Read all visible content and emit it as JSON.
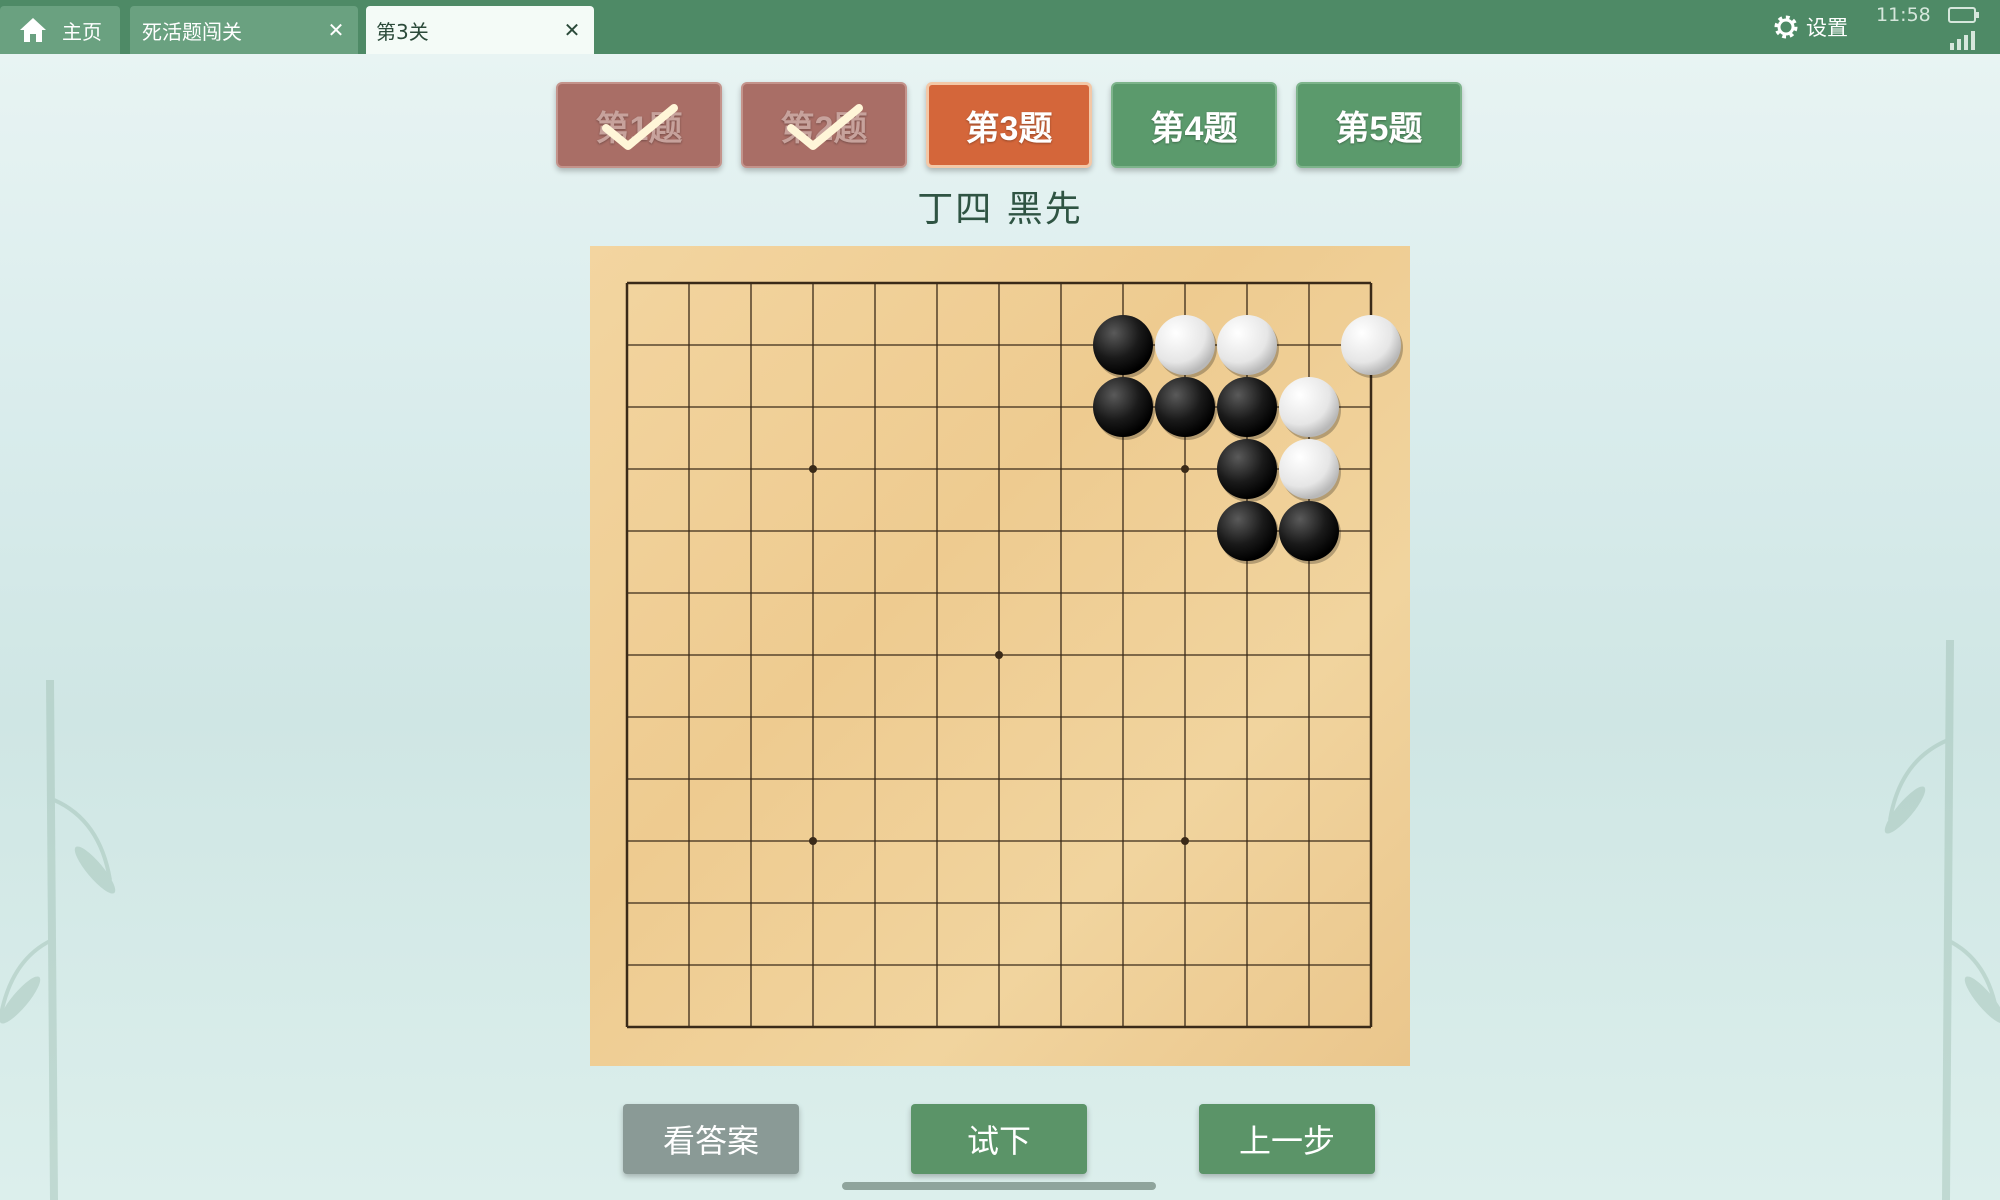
{
  "topbar": {
    "tabs": [
      {
        "label": "主页",
        "icon": "home-icon"
      },
      {
        "label": "死活题闯关",
        "close": "✕"
      },
      {
        "label": "第3关",
        "close": "✕",
        "active": true
      }
    ],
    "settings_label": "设置",
    "settings_icon": "gear-icon",
    "clock": "11:58"
  },
  "problems": [
    {
      "label": "第1题",
      "state": "done"
    },
    {
      "label": "第2题",
      "state": "done"
    },
    {
      "label": "第3题",
      "state": "current"
    },
    {
      "label": "第4题",
      "state": "todo"
    },
    {
      "label": "第5题",
      "state": "todo"
    }
  ],
  "subtitle": "丁四  黑先",
  "board": {
    "size": 13,
    "star_points": [
      [
        3,
        3
      ],
      [
        9,
        3
      ],
      [
        6,
        6
      ],
      [
        3,
        9
      ],
      [
        9,
        9
      ]
    ],
    "stones": [
      {
        "col": 8,
        "row": 1,
        "color": "black"
      },
      {
        "col": 9,
        "row": 1,
        "color": "white"
      },
      {
        "col": 10,
        "row": 1,
        "color": "white"
      },
      {
        "col": 12,
        "row": 1,
        "color": "white"
      },
      {
        "col": 8,
        "row": 2,
        "color": "black"
      },
      {
        "col": 9,
        "row": 2,
        "color": "black"
      },
      {
        "col": 10,
        "row": 2,
        "color": "black"
      },
      {
        "col": 11,
        "row": 2,
        "color": "white"
      },
      {
        "col": 10,
        "row": 3,
        "color": "black"
      },
      {
        "col": 11,
        "row": 3,
        "color": "white"
      },
      {
        "col": 10,
        "row": 4,
        "color": "black"
      },
      {
        "col": 11,
        "row": 4,
        "color": "black"
      }
    ]
  },
  "actions": {
    "answer": "看答案",
    "try": "试下",
    "undo": "上一步"
  },
  "colors": {
    "topbar": "#4e8a66",
    "done": "#a96e66",
    "current": "#d4663a",
    "todo": "#5b9a6c"
  }
}
